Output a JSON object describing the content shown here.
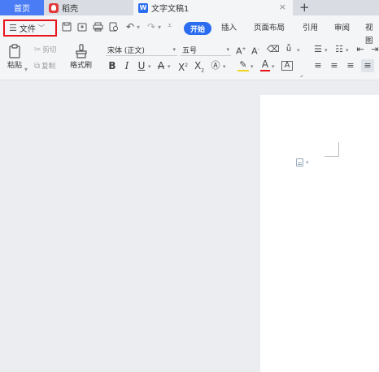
{
  "tabs": {
    "home": "首页",
    "daoke": "稻壳",
    "document": "文字文稿1",
    "doc_icon_letter": "W",
    "close_glyph": "×",
    "add_glyph": "+"
  },
  "file_menu": {
    "label": "文件"
  },
  "quick_access": {
    "icons": [
      "save-icon",
      "export-icon",
      "print-icon",
      "print-preview-icon",
      "undo-icon",
      "redo-icon",
      "customize-icon"
    ]
  },
  "menu": {
    "start": "开始",
    "insert": "插入",
    "layout": "页面布局",
    "reference": "引用",
    "review": "审阅",
    "view": "视图"
  },
  "clipboard": {
    "paste": "粘贴",
    "cut": "剪切",
    "copy": "复制",
    "format_painter": "格式刷"
  },
  "font": {
    "name": "宋体 (正文)",
    "size": "五号"
  },
  "accent_color": "#2b6df0",
  "highlight_color": "#e8141b"
}
